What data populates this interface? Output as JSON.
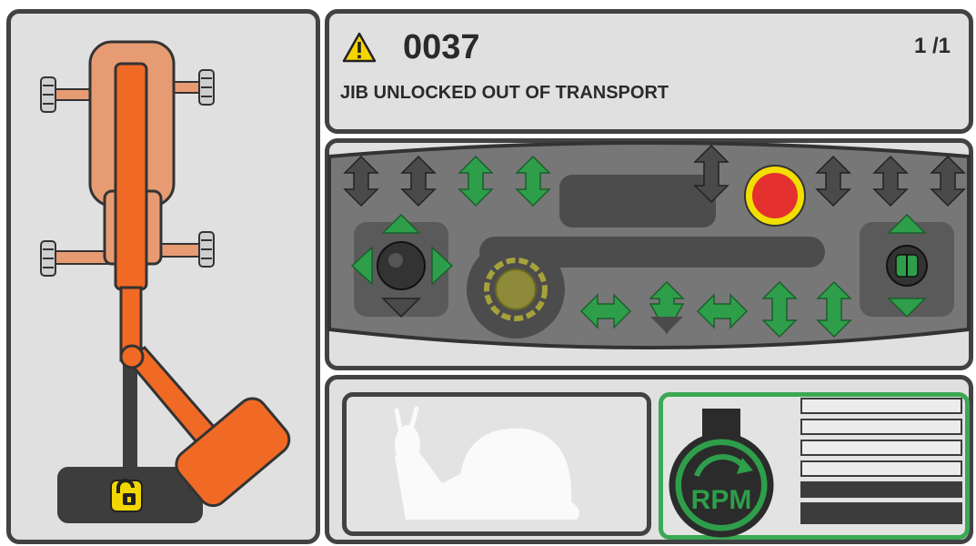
{
  "alarm": {
    "code": "0037",
    "page": "1 /1",
    "message": "JIB UNLOCKED OUT OF TRANSPORT",
    "severity_icon": "warning-triangle-icon"
  },
  "machine": {
    "lock_state": "unlocked",
    "lock_icon": "unlocked-padlock-icon"
  },
  "controls": {
    "emergency_stop_icon": "emergency-stop-icon",
    "joystick_icon": "joystick-icon",
    "dial_icon": "dial-icon",
    "colors": {
      "active": "#2e9e4a",
      "inactive": "#4a4a4a",
      "estop": "#e53030",
      "estop_ring": "#f2df00"
    }
  },
  "status": {
    "slow_mode_icon": "snail-icon",
    "rpm_label": "RPM",
    "rpm_icon": "engine-rpm-icon",
    "rpm_level": 0.4,
    "colors": {
      "rpm_active": "#3aa854",
      "bar_filled": "#3c3c3c",
      "bar_empty": "#ececec"
    }
  }
}
